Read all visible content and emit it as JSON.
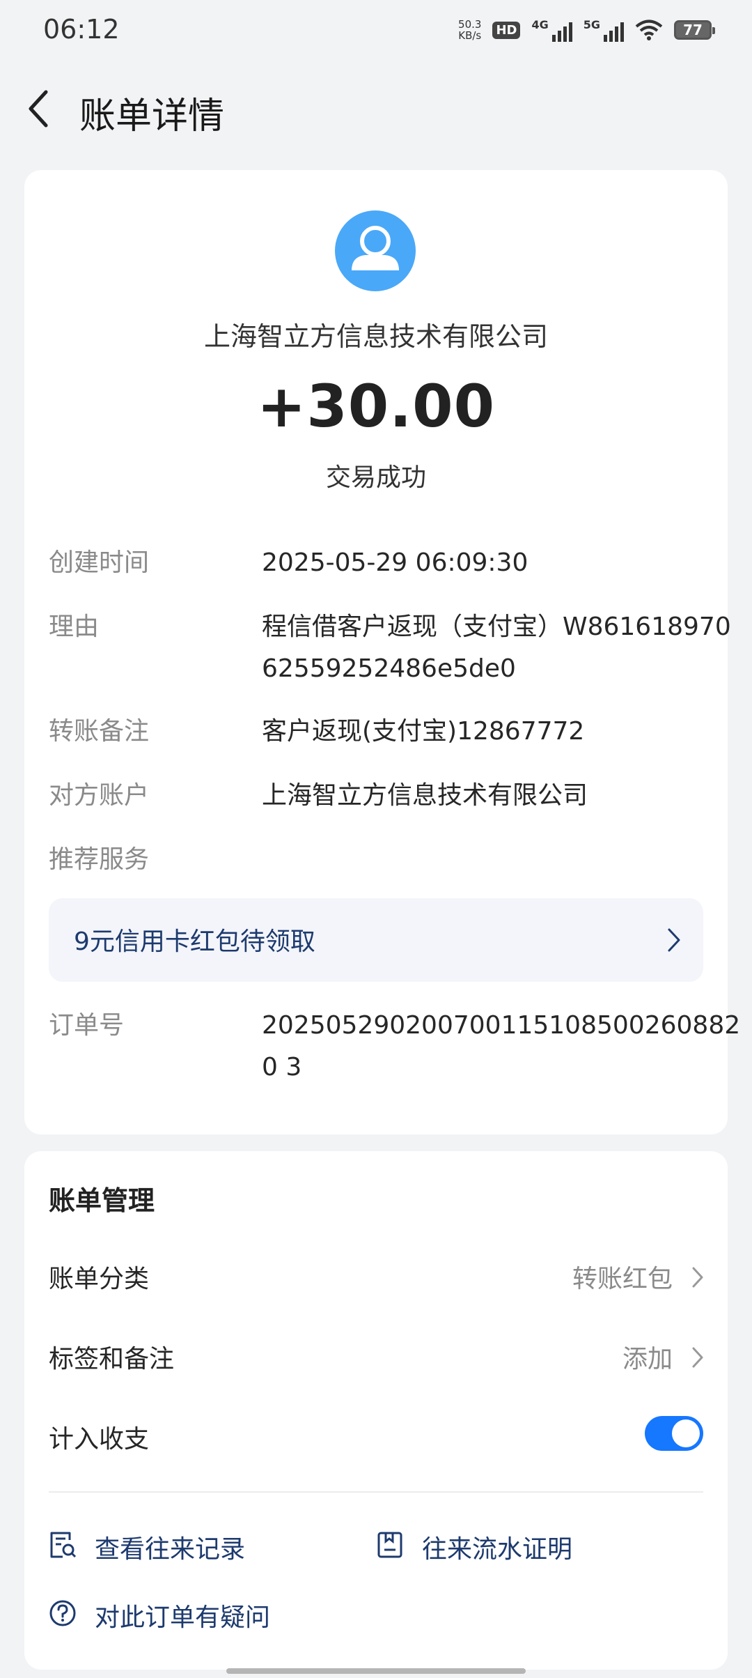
{
  "status_bar": {
    "time": "06:12",
    "net_speed": "50.3",
    "net_unit": "KB/s",
    "hd": "HD",
    "sig1_label": "4G",
    "sig2_label": "5G",
    "battery": "77"
  },
  "header": {
    "title": "账单详情"
  },
  "summary": {
    "company": "上海智立方信息技术有限公司",
    "amount": "+30.00",
    "status": "交易成功"
  },
  "details": [
    {
      "key": "创建时间",
      "value": "2025-05-29 06:09:30"
    },
    {
      "key": "理由",
      "value": "程信借客户返现（支付宝）W86161897062559252486e5de0"
    },
    {
      "key": "转账备注",
      "value": "客户返现(支付宝)12867772"
    },
    {
      "key": "对方账户",
      "value": "上海智立方信息技术有限公司"
    },
    {
      "key": "推荐服务",
      "value": ""
    },
    {
      "key": "订单号",
      "value": "2025052902007001151085002608820 3"
    }
  ],
  "promo": {
    "text": "9元信用卡红包待领取"
  },
  "management": {
    "title": "账单管理",
    "category_label": "账单分类",
    "category_value": "转账红包",
    "tags_label": "标签和备注",
    "tags_value": "添加",
    "include_label": "计入收支",
    "include_on": true,
    "link_records": "查看往来记录",
    "link_proof": "往来流水证明",
    "link_question": "对此订单有疑问"
  },
  "colors": {
    "accent": "#1677ff",
    "link": "#1d3a6e",
    "avatar": "#4aa8f8"
  }
}
